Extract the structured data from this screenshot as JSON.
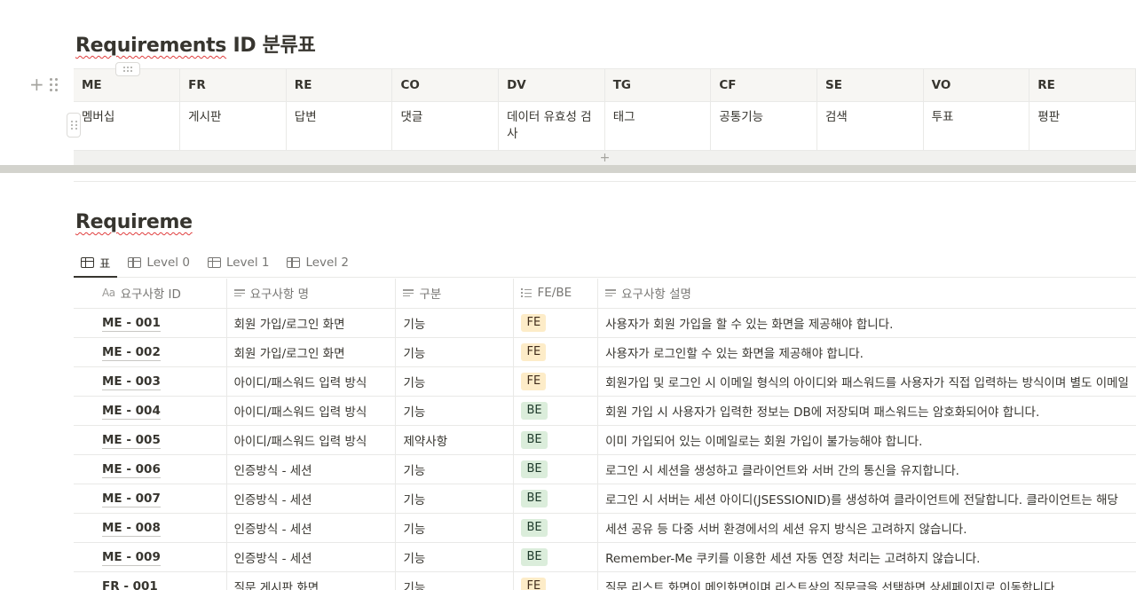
{
  "section1": {
    "title_prefix": "Requirements",
    "title_suffix": " ID 분류표",
    "add_row_symbol": "+",
    "headers": [
      "ME",
      "FR",
      "RE",
      "CO",
      "DV",
      "TG",
      "CF",
      "SE",
      "VO",
      "RE"
    ],
    "values": [
      "멤버십",
      "게시판",
      "답변",
      "댓글",
      "데이터 유효성 검사",
      "태그",
      "공통기능",
      "검색",
      "투표",
      "평판"
    ]
  },
  "section2": {
    "title": "Requireme",
    "tabs": [
      {
        "label": "표"
      },
      {
        "label": "Level 0"
      },
      {
        "label": "Level 1"
      },
      {
        "label": "Level 2"
      }
    ],
    "columns": {
      "id_prefix": "Aa",
      "id": "요구사항 ID",
      "name": "요구사항 명",
      "type": "구분",
      "febe": "FE/BE",
      "desc": "요구사항 설명"
    },
    "rows": [
      {
        "id": "ME - 001",
        "name": "회원 가입/로그인 화면",
        "type": "기능",
        "tag": "FE",
        "desc": "사용자가 회원 가입을 할 수 있는 화면을 제공해야 합니다."
      },
      {
        "id": "ME - 002",
        "name": "회원 가입/로그인 화면",
        "type": "기능",
        "tag": "FE",
        "desc": "사용자가 로그인할 수 있는 화면을 제공해야 합니다."
      },
      {
        "id": "ME - 003",
        "name": "아이디/패스워드 입력 방식",
        "type": "기능",
        "tag": "FE",
        "desc": "회원가입 및 로그인 시 이메일 형식의 아이디와 패스워드를 사용자가 직접 입력하는 방식이며 별도 이메일"
      },
      {
        "id": "ME - 004",
        "name": "아이디/패스워드 입력 방식",
        "type": "기능",
        "tag": "BE",
        "desc": "회원 가입 시 사용자가 입력한 정보는 DB에 저장되며 패스워드는 암호화되어야 합니다."
      },
      {
        "id": "ME - 005",
        "name": "아이디/패스워드 입력 방식",
        "type": "제약사항",
        "tag": "BE",
        "desc": "이미 가입되어 있는 이메일로는 회원 가입이 불가능해야 합니다."
      },
      {
        "id": "ME - 006",
        "name": "인증방식 - 세션",
        "type": "기능",
        "tag": "BE",
        "desc": "로그인 시 세션을 생성하고 클라이언트와 서버 간의 통신을 유지합니다."
      },
      {
        "id": "ME - 007",
        "name": "인증방식 - 세션",
        "type": "기능",
        "tag": "BE",
        "desc": "로그인 시 서버는 세션 아이디(JSESSIONID)를 생성하여 클라이언트에 전달합니다. 클라이언트는 해당"
      },
      {
        "id": "ME - 008",
        "name": "인증방식 - 세션",
        "type": "기능",
        "tag": "BE",
        "desc": "세션 공유 등 다중 서버 환경에서의 세션 유지 방식은 고려하지 않습니다."
      },
      {
        "id": "ME - 009",
        "name": "인증방식 - 세션",
        "type": "기능",
        "tag": "BE",
        "desc": "Remember-Me 쿠키를 이용한 세션 자동 연장 처리는 고려하지 않습니다."
      },
      {
        "id": "FR - 001",
        "name": "질문 게시판 화면",
        "type": "기능",
        "tag": "FE",
        "desc": "질문 리스트 화면이 메인화면이며 리스트상의 질문글을 선택하면 상세페이지로 이동합니다."
      }
    ]
  }
}
